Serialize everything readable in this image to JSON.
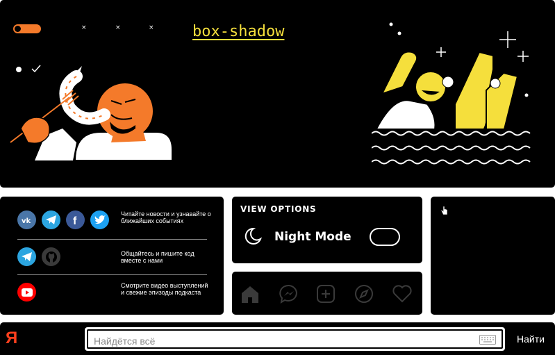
{
  "hero": {
    "title": "box-shadow",
    "tiny_marks": [
      "×",
      "×",
      "×"
    ]
  },
  "social": {
    "rows": [
      {
        "icons": [
          "vk-icon",
          "telegram-icon",
          "facebook-icon",
          "twitter-icon"
        ],
        "text": "Читайте новости и узнавайте о ближайших событиях"
      },
      {
        "icons": [
          "telegram-icon",
          "github-icon"
        ],
        "text": "Общайтесь и пишите код вместе с нами"
      },
      {
        "icons": [
          "youtube-icon"
        ],
        "text": "Смотрите видео выступлений и свежие эпизоды подкаста"
      }
    ],
    "colors": {
      "vk": "#4a76a8",
      "telegram": "#2ca5e0",
      "facebook": "#3b5998",
      "twitter": "#1da1f2",
      "github": "#3a3a3a",
      "youtube": "#ff0000"
    }
  },
  "view_options": {
    "title": "VIEW OPTIONS",
    "night_mode_label": "Night Mode",
    "night_mode_on": false
  },
  "nav": {
    "items": [
      "home-icon",
      "messenger-icon",
      "add-icon",
      "explore-icon",
      "heart-icon"
    ]
  },
  "search": {
    "logo": "Я",
    "placeholder": "Найдётся всё",
    "value": "",
    "button_label": "Найти"
  },
  "colors": {
    "accent_yellow": "#f5df3c",
    "accent_orange": "#f47a2a",
    "brand_red": "#fc3f1d"
  }
}
